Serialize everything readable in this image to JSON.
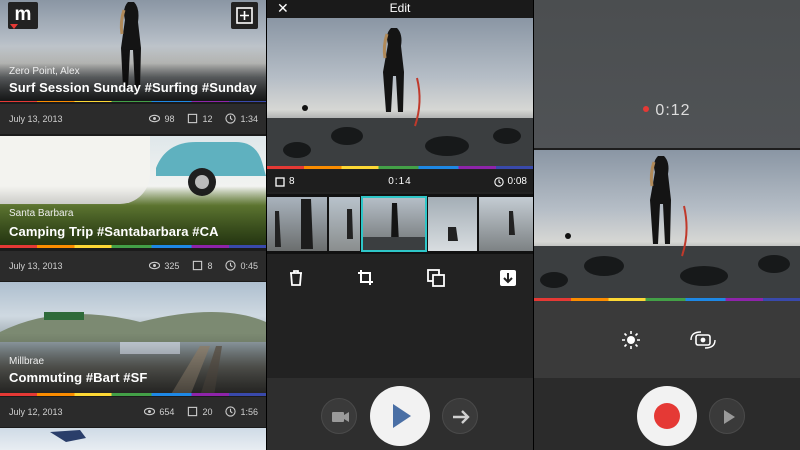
{
  "feed": {
    "cards": [
      {
        "location": "Zero Point, Alex",
        "title": "Surf Session Sunday #Surfing #Sunday",
        "date": "July 13, 2013",
        "views": "98",
        "clips": "12",
        "duration": "1:34"
      },
      {
        "location": "Santa Barbara",
        "title": "Camping Trip #Santabarbara #CA",
        "date": "July 13, 2013",
        "views": "325",
        "clips": "8",
        "duration": "0:45"
      },
      {
        "location": "Millbrae",
        "title": "Commuting #Bart #SF",
        "date": "July 12, 2013",
        "views": "654",
        "clips": "20",
        "duration": "1:56"
      }
    ],
    "logo_letter": "m"
  },
  "edit": {
    "title": "Edit",
    "clip_count": "8",
    "position_time": "0:14",
    "clip_duration": "0:08"
  },
  "record": {
    "timer": "0:12"
  },
  "icons": [
    "logo-icon",
    "add-icon",
    "views-icon",
    "clips-icon",
    "clock-icon",
    "close-icon",
    "trash-icon",
    "crop-icon",
    "duplicate-icon",
    "save-icon",
    "camera-icon",
    "play-icon",
    "arrow-right-icon",
    "brightness-icon",
    "flip-camera-icon",
    "record-icon"
  ],
  "colors": {
    "selection": "#2ec6c8",
    "record": "#e53935",
    "play": "#4a6fa5"
  }
}
